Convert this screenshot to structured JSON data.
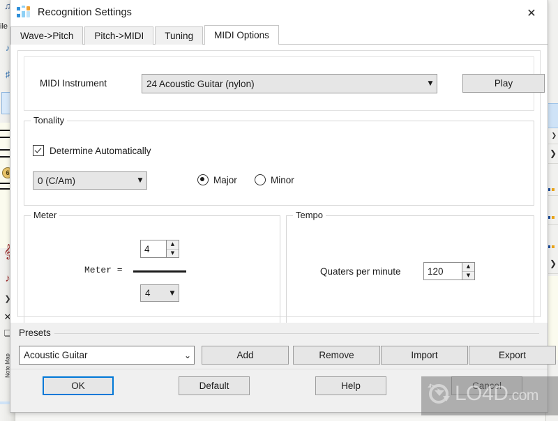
{
  "window": {
    "title": "Recognition Settings",
    "icon": "audio-faders-icon",
    "close_label": "✕"
  },
  "tabs": [
    {
      "label": "Wave->Pitch",
      "active": false
    },
    {
      "label": "Pitch->MIDI",
      "active": false
    },
    {
      "label": "Tuning",
      "active": false
    },
    {
      "label": "MIDI Options",
      "active": true
    }
  ],
  "instrument": {
    "label": "MIDI Instrument",
    "value": "24 Acoustic Guitar (nylon)",
    "arrow": "▼",
    "play_label": "Play"
  },
  "tonality": {
    "title": "Tonality",
    "auto_label": "Determine Automatically",
    "auto_checked": true,
    "key_value": "0 (C/Am)",
    "key_arrow": "▼",
    "major_label": "Major",
    "minor_label": "Minor",
    "selected_mode": "Major"
  },
  "meter": {
    "title": "Meter",
    "equals_label": "Meter  =",
    "numerator": "4",
    "denominator": "4",
    "denominator_arrow": "▼",
    "spin_up": "▲",
    "spin_down": "▼"
  },
  "tempo": {
    "title": "Tempo",
    "label": "Quaters per minute",
    "value": "120",
    "spin_up": "▲",
    "spin_down": "▼"
  },
  "presets": {
    "title": "Presets",
    "value": "Acoustic Guitar",
    "arrow": "⌄",
    "add_label": "Add",
    "remove_label": "Remove",
    "import_label": "Import",
    "export_label": "Export"
  },
  "footer": {
    "ok_label": "OK",
    "default_label": "Default",
    "help_label": "Help",
    "cancel_label": "Cancel"
  },
  "watermark": {
    "text": "LO4D",
    "suffix": ".com",
    "logo": "refresh-arrows-icon"
  },
  "background": {
    "file_menu_fragment": "ile",
    "note_map_label": "Note Map",
    "left_tools": [
      "♫",
      "✎",
      "□"
    ],
    "right_icons": [
      "»",
      "»",
      "»"
    ]
  },
  "colors": {
    "accent": "#0078d7",
    "dialog_bg": "#f0f0f0",
    "page_bg": "#ffffff",
    "control_bg": "#e6e6e6",
    "group_border": "#d5d5d5"
  }
}
